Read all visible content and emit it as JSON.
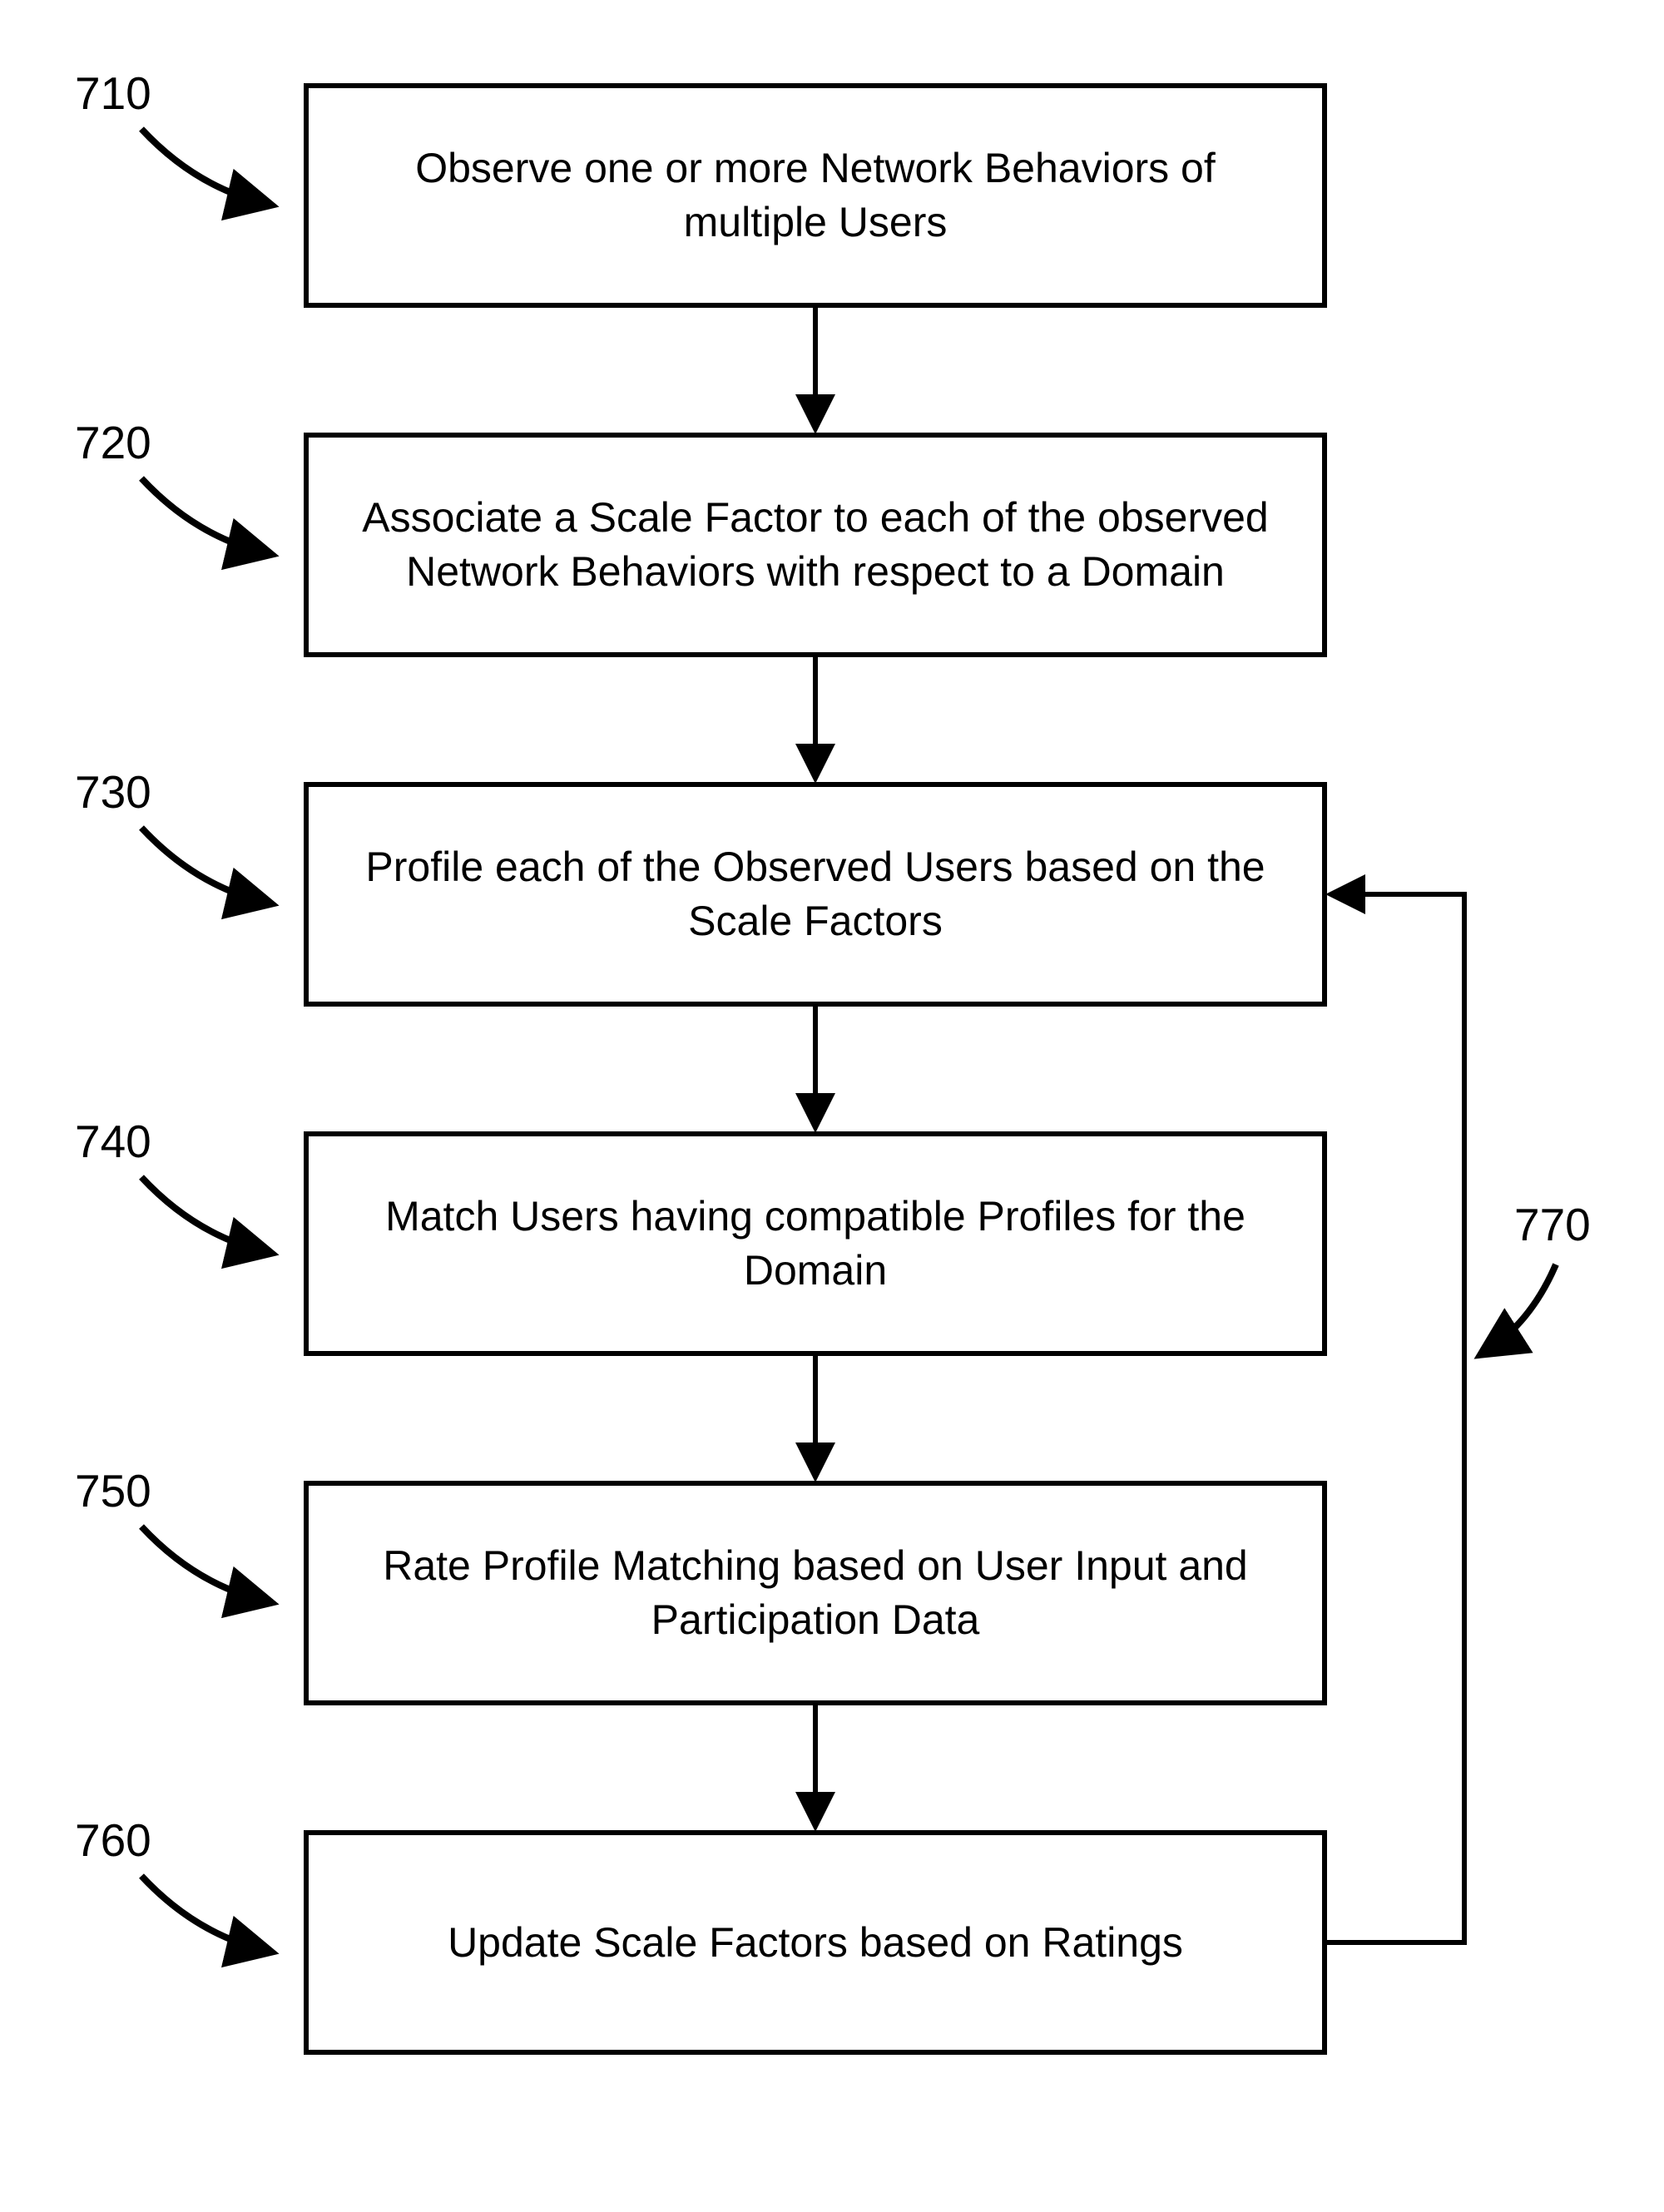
{
  "chart_data": {
    "type": "flowchart",
    "steps": [
      {
        "id": "710",
        "label": "710",
        "text": "Observe one or more Network Behaviors of multiple Users"
      },
      {
        "id": "720",
        "label": "720",
        "text": "Associate a Scale Factor to each of the observed Network Behaviors with respect to a Domain"
      },
      {
        "id": "730",
        "label": "730",
        "text": "Profile each of the Observed Users based on the Scale Factors"
      },
      {
        "id": "740",
        "label": "740",
        "text": "Match Users having compatible Profiles for the Domain"
      },
      {
        "id": "750",
        "label": "750",
        "text": "Rate Profile Matching based on User Input and Participation Data"
      },
      {
        "id": "760",
        "label": "760",
        "text": "Update Scale Factors based on Ratings"
      }
    ],
    "feedback": {
      "id": "770",
      "label": "770",
      "from": "760",
      "to": "730"
    },
    "edges": [
      {
        "from": "710",
        "to": "720"
      },
      {
        "from": "720",
        "to": "730"
      },
      {
        "from": "730",
        "to": "740"
      },
      {
        "from": "740",
        "to": "750"
      },
      {
        "from": "750",
        "to": "760"
      },
      {
        "from": "760",
        "to": "730",
        "feedback": true
      }
    ]
  }
}
